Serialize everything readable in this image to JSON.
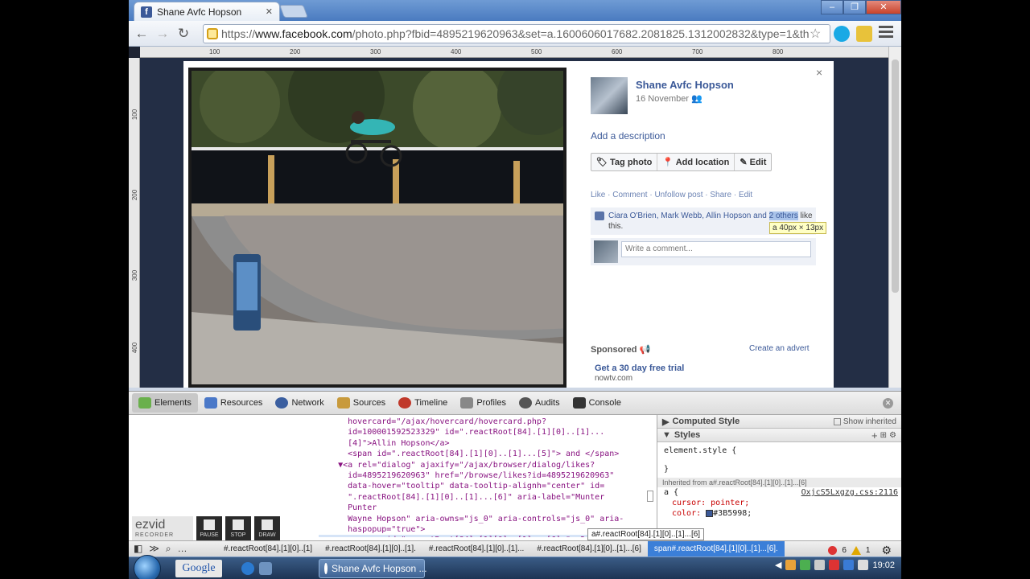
{
  "browser": {
    "tab_title": "Shane Avfc Hopson",
    "tab_close": "✕",
    "url_scheme": "https://",
    "url_host": "www.facebook.com",
    "url_path": "/photo.php?fbid=4895219620963&set=a.1600606017682.2081825.1312002832&type=1&th",
    "fb_icon": "f"
  },
  "ruler": {
    "h_labels": [
      "100",
      "200",
      "300",
      "400",
      "500",
      "600",
      "700",
      "800"
    ],
    "v_labels": [
      "100",
      "200",
      "300",
      "400"
    ]
  },
  "post": {
    "poster_name": "Shane Avfc Hopson",
    "date": "16 November",
    "add_description": "Add a description",
    "tag_photo": "Tag photo",
    "add_location": "Add location",
    "edit": "Edit",
    "actions": "Like · Comment · Unfollow post · Share · Edit",
    "likes_prefix": "Ciara O'Brien, Mark Webb, Allin Hopson and ",
    "likes_others": "2 others",
    "likes_suffix": " like",
    "likes_line2": "this.",
    "tooltip": "a 40px × 13px",
    "comment_placeholder": "Write a comment...",
    "close": "×"
  },
  "ads": {
    "sponsored": "Sponsored",
    "create_advert": "Create an advert",
    "ad_title": "Get a 30 day free trial",
    "ad_site": "nowtv.com"
  },
  "devtools": {
    "tabs": [
      {
        "label": "Elements",
        "color": "#6ab04c"
      },
      {
        "label": "Resources",
        "color": "#4a78c8"
      },
      {
        "label": "Network",
        "color": "#3b5fa0"
      },
      {
        "label": "Sources",
        "color": "#c89a3c"
      },
      {
        "label": "Timeline",
        "color": "#c0392b"
      },
      {
        "label": "Profiles",
        "color": "#888888"
      },
      {
        "label": "Audits",
        "color": "#555555"
      },
      {
        "label": "Console",
        "color": "#333333"
      }
    ],
    "code_lines": [
      "      hovercard=\"/ajax/hovercard/hovercard.php?",
      "      id=100001592523329\" id=\".reactRoot[84].[1][0]..[1]...",
      "      [4]\">Allin Hopson</a>",
      "      <span id=\".reactRoot[84].[1][0]..[1]...[5]\"> and </span>",
      "    ▼<a rel=\"dialog\" ajaxify=\"/ajax/browser/dialog/likes?",
      "      id=4895219620963\" href=\"/browse/likes?id=4895219620963\"",
      "      data-hover=\"tooltip\" data-tooltip-alignh=\"center\" id=",
      "      \".reactRoot[84].[1][0]..[1]...[6]\" aria-label=\"Munter",
      "      Punter",
      "      Wayne Hopson\" aria-owns=\"js_0\" aria-controls=\"js_0\" aria-",
      "      haspopup=\"true\">",
      "        <span id=\".reactRoot[84].[1][0]..[1]...[6].\"> 2"
    ],
    "computed_style": "Computed Style",
    "show_inherited": "Show inherited",
    "styles": "Styles",
    "element_style": "element.style {",
    "close_brace": "}",
    "inherited_from": "Inherited from a#.reactRoot[84].[1][0]..[1]...[6]",
    "rule_selector": "a {",
    "rule_source": "OxjcS5Lxgzg.css:2116",
    "prop1": "cursor: pointer;",
    "prop2_name": "color: ",
    "prop2_value": "#3B5998;",
    "crumbs": [
      "#.reactRoot[84].[1][0]..[1]",
      "#.reactRoot[84].[1][0]..[1].",
      "#.reactRoot[84].[1][0]..[1]...",
      "#.reactRoot[84].[1][0]..[1]...[6]",
      "span#.reactRoot[84].[1][0]..[1]...[6]."
    ],
    "crumb_tip": "a#.reactRoot[84].[1][0]..[1]...[6]",
    "errors": "6",
    "warnings": "1"
  },
  "ezvid": {
    "logo": "ezvid",
    "sub": "RECORDER",
    "pause": "PAUSE",
    "stop": "STOP",
    "draw": "DRAW"
  },
  "taskbar": {
    "google": "Google",
    "task_label": "Shane Avfc Hopson ...",
    "clock": "19:02"
  }
}
